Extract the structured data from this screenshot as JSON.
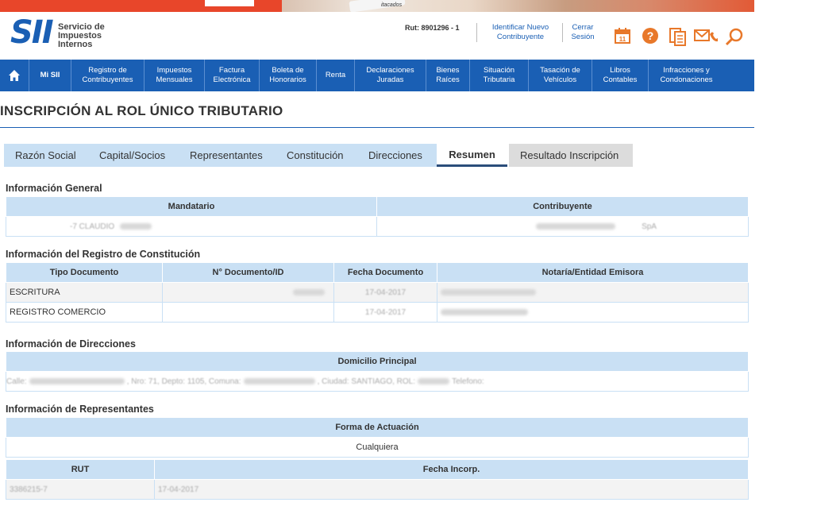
{
  "banner": {
    "photo_text": "itacados"
  },
  "header": {
    "logo_mark": "SII",
    "logo_line1": "Servicio de",
    "logo_line2": "Impuestos",
    "logo_line3": "Internos",
    "rut_text": "Rut: 8901296 - 1",
    "identificar_line1": "Identificar Nuevo",
    "identificar_line2": "Contribuyente",
    "cerrar_line1": "Cerrar",
    "cerrar_line2": "Sesión",
    "icons": [
      "calendar-icon",
      "help-icon",
      "documents-icon",
      "contact-icon",
      "search-icon"
    ],
    "calendar_day": "11"
  },
  "nav": {
    "items": [
      {
        "line1": "Mi SII",
        "line2": ""
      },
      {
        "line1": "Registro de",
        "line2": "Contribuyentes"
      },
      {
        "line1": "Impuestos",
        "line2": "Mensuales"
      },
      {
        "line1": "Factura",
        "line2": "Electrónica"
      },
      {
        "line1": "Boleta de",
        "line2": "Honorarios"
      },
      {
        "line1": "Renta",
        "line2": ""
      },
      {
        "line1": "Declaraciones",
        "line2": "Juradas"
      },
      {
        "line1": "Bienes",
        "line2": "Raíces"
      },
      {
        "line1": "Situación",
        "line2": "Tributaria"
      },
      {
        "line1": "Tasación de",
        "line2": "Vehículos"
      },
      {
        "line1": "Libros",
        "line2": "Contables"
      },
      {
        "line1": "Infracciones y",
        "line2": "Condonaciones"
      }
    ]
  },
  "page_title": "INSCRIPCIÓN AL ROL ÚNICO TRIBUTARIO",
  "tabs": [
    "Razón Social",
    "Capital/Socios",
    "Representantes",
    "Constitución",
    "Direcciones",
    "Resumen",
    "Resultado Inscripción"
  ],
  "info_general": {
    "title": "Información General",
    "col_mandatario": "Mandatario",
    "col_contribuyente": "Contribuyente",
    "mandatario_value": "-7  CLAUDIO",
    "contribuyente_value": "SpA"
  },
  "registro": {
    "title": "Información del Registro de Constitución",
    "headers": [
      "Tipo Documento",
      "N° Documento/ID",
      "Fecha Documento",
      "Notaría/Entidad Emisora"
    ],
    "rows": [
      {
        "tipo": "ESCRITURA",
        "fecha": "17-04-2017"
      },
      {
        "tipo": "REGISTRO COMERCIO",
        "fecha": "17-04-2017"
      }
    ]
  },
  "direcciones": {
    "title": "Información de Direcciones",
    "header": "Domicilio Principal",
    "value_a": "Calle:",
    "value_b": ", Nro: 71, Depto: 1105, Comuna:",
    "value_c": ", Ciudad: SANTIAGO, ROL:",
    "value_d": "Telefono:"
  },
  "representantes": {
    "title": "Información de Representantes",
    "forma_header": "Forma de Actuación",
    "forma_value": "Cualquiera",
    "col_rut": "RUT",
    "col_fecha": "Fecha Incorp.",
    "row_rut": "3386215-7",
    "row_fecha": "17-04-2017"
  }
}
